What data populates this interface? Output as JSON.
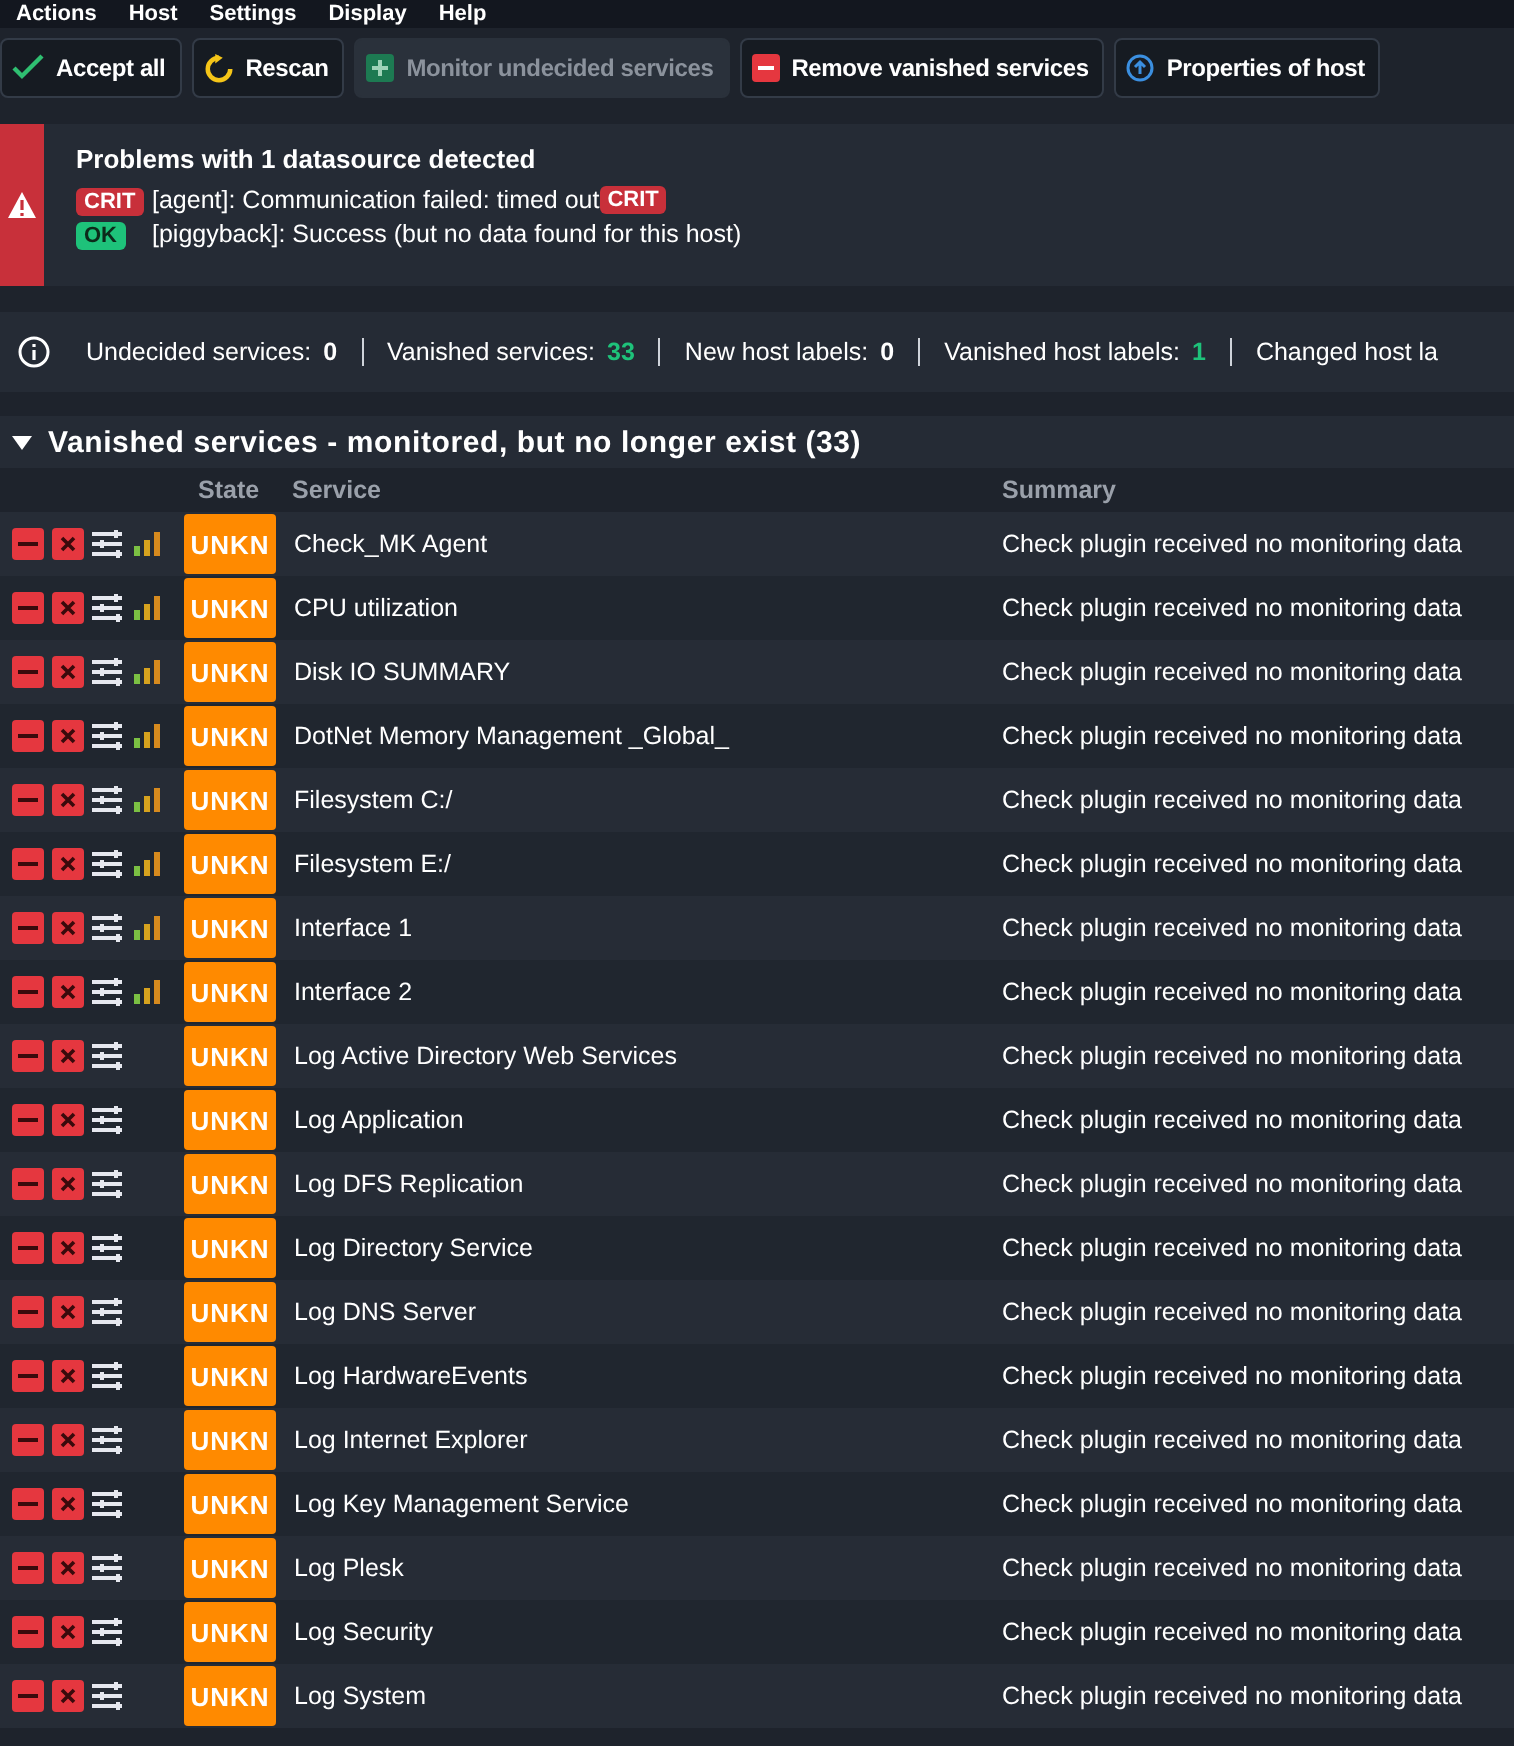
{
  "menu": [
    "Actions",
    "Host",
    "Settings",
    "Display",
    "Help"
  ],
  "toolbar": [
    {
      "label": "Accept all",
      "kind": "check",
      "disabled": false
    },
    {
      "label": "Rescan",
      "kind": "rescan",
      "disabled": false
    },
    {
      "label": "Monitor undecided services",
      "kind": "plus",
      "disabled": true
    },
    {
      "label": "Remove vanished services",
      "kind": "minus",
      "disabled": false
    },
    {
      "label": "Properties of host",
      "kind": "up",
      "disabled": false
    }
  ],
  "problem": {
    "title": "Problems with 1 datasource detected",
    "lines": [
      {
        "state": "CRIT",
        "text": "[agent]: Communication failed: timed out",
        "trailing_state": "CRIT"
      },
      {
        "state": "OK",
        "text": "[piggyback]: Success (but no data found for this host)"
      }
    ]
  },
  "summary": [
    {
      "label": "Undecided services:",
      "value": "0",
      "highlight": false
    },
    {
      "label": "Vanished services:",
      "value": "33",
      "highlight": true
    },
    {
      "label": "New host labels:",
      "value": "0",
      "highlight": false
    },
    {
      "label": "Vanished host labels:",
      "value": "1",
      "highlight": true
    },
    {
      "label": "Changed host la"
    }
  ],
  "section": {
    "title": "Vanished services - monitored, but no longer exist (33)",
    "expanded": true
  },
  "columns": [
    "State",
    "Service",
    "Summary"
  ],
  "rows": [
    {
      "state": "UNKN",
      "service": "Check_MK Agent",
      "summary": "Check plugin received no monitoring data",
      "graphs": true
    },
    {
      "state": "UNKN",
      "service": "CPU utilization",
      "summary": "Check plugin received no monitoring data",
      "graphs": true
    },
    {
      "state": "UNKN",
      "service": "Disk IO SUMMARY",
      "summary": "Check plugin received no monitoring data",
      "graphs": true
    },
    {
      "state": "UNKN",
      "service": "DotNet Memory Management _Global_",
      "summary": "Check plugin received no monitoring data",
      "graphs": true
    },
    {
      "state": "UNKN",
      "service": "Filesystem C:/",
      "summary": "Check plugin received no monitoring data",
      "graphs": true
    },
    {
      "state": "UNKN",
      "service": "Filesystem E:/",
      "summary": "Check plugin received no monitoring data",
      "graphs": true
    },
    {
      "state": "UNKN",
      "service": "Interface 1",
      "summary": "Check plugin received no monitoring data",
      "graphs": true
    },
    {
      "state": "UNKN",
      "service": "Interface 2",
      "summary": "Check plugin received no monitoring data",
      "graphs": true
    },
    {
      "state": "UNKN",
      "service": "Log Active Directory Web Services",
      "summary": "Check plugin received no monitoring data",
      "graphs": false
    },
    {
      "state": "UNKN",
      "service": "Log Application",
      "summary": "Check plugin received no monitoring data",
      "graphs": false
    },
    {
      "state": "UNKN",
      "service": "Log DFS Replication",
      "summary": "Check plugin received no monitoring data",
      "graphs": false
    },
    {
      "state": "UNKN",
      "service": "Log Directory Service",
      "summary": "Check plugin received no monitoring data",
      "graphs": false
    },
    {
      "state": "UNKN",
      "service": "Log DNS Server",
      "summary": "Check plugin received no monitoring data",
      "graphs": false
    },
    {
      "state": "UNKN",
      "service": "Log HardwareEvents",
      "summary": "Check plugin received no monitoring data",
      "graphs": false
    },
    {
      "state": "UNKN",
      "service": "Log Internet Explorer",
      "summary": "Check plugin received no monitoring data",
      "graphs": false
    },
    {
      "state": "UNKN",
      "service": "Log Key Management Service",
      "summary": "Check plugin received no monitoring data",
      "graphs": false
    },
    {
      "state": "UNKN",
      "service": "Log Plesk",
      "summary": "Check plugin received no monitoring data",
      "graphs": false
    },
    {
      "state": "UNKN",
      "service": "Log Security",
      "summary": "Check plugin received no monitoring data",
      "graphs": false
    },
    {
      "state": "UNKN",
      "service": "Log System",
      "summary": "Check plugin received no monitoring data",
      "graphs": false
    }
  ]
}
